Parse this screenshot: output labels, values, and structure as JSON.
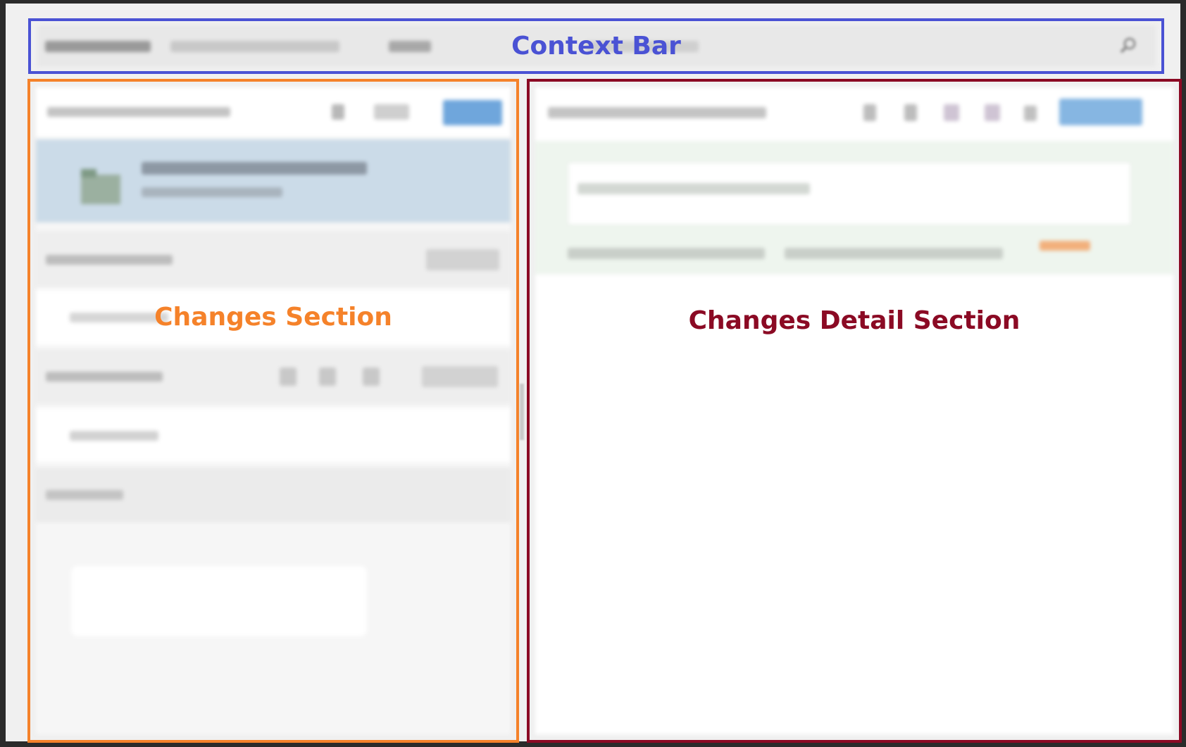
{
  "labels": {
    "context_bar": "Context Bar",
    "changes_section": "Changes Section",
    "changes_detail_section": "Changes Detail Section"
  },
  "colors": {
    "context_bar": "#4a52d4",
    "changes_section": "#f5822a",
    "changes_detail_section": "#8b0a24"
  },
  "icons": {
    "context_search": "search-icon",
    "repo_status": "folder-icon"
  }
}
